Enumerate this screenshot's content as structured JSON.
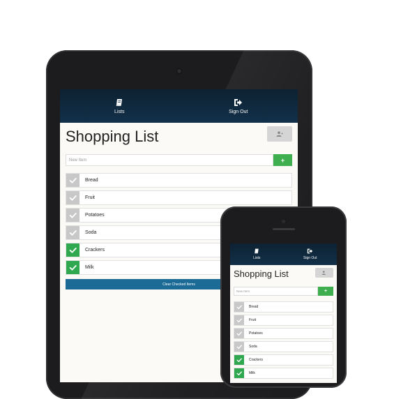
{
  "nav": {
    "lists_label": "Lists",
    "signout_label": "Sign Out",
    "lists_icon": "book-icon",
    "signout_icon": "sign-out-icon"
  },
  "page": {
    "title": "Shopping List",
    "share_icon": "user-share-icon"
  },
  "new_item": {
    "placeholder": "New Item",
    "add_label": "+"
  },
  "items": [
    {
      "label": "Bread",
      "checked": false
    },
    {
      "label": "Fruit",
      "checked": false
    },
    {
      "label": "Potatoes",
      "checked": false
    },
    {
      "label": "Soda",
      "checked": false
    },
    {
      "label": "Crackers",
      "checked": true
    },
    {
      "label": "Milk",
      "checked": true
    }
  ],
  "clear_button": "Clear Checked Items",
  "colors": {
    "navbar": "#0f2a40",
    "checked": "#2fa84f",
    "unchecked": "#c8c8c8",
    "add_button": "#3fae4f",
    "clear_button": "#1c6b97"
  }
}
